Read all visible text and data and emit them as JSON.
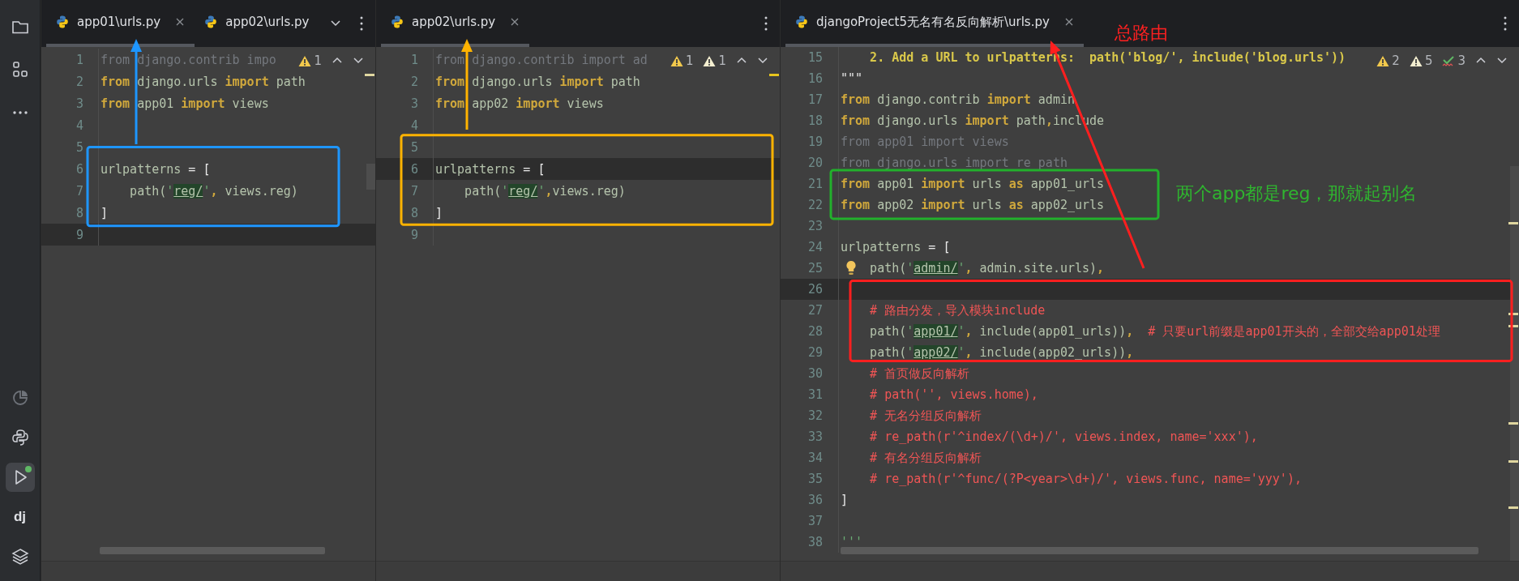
{
  "sidebar": {
    "top": [
      {
        "selected": false
      },
      {
        "selected": false
      },
      {
        "selected": false
      }
    ],
    "bottom": [
      {
        "kind": "icon",
        "selected": false
      },
      {
        "kind": "icon",
        "selected": false
      },
      {
        "kind": "icon",
        "selected": true,
        "running": true
      },
      {
        "kind": "label",
        "label": "dj",
        "selected": false
      },
      {
        "kind": "icon",
        "selected": false
      }
    ]
  },
  "panes": [
    {
      "tabs": [
        {
          "label": "app01\\urls.py",
          "selected": true,
          "closable": true
        },
        {
          "label": "app02\\urls.py",
          "selected": false,
          "closable": false
        }
      ],
      "tab_overflow": true,
      "inspections": [
        {
          "kind": "warning",
          "count": "1"
        }
      ],
      "lines": [
        {
          "number": "1",
          "current": false,
          "segments": [
            {
              "text": "from django.contrib impo",
              "kind": "dim"
            }
          ]
        },
        {
          "number": "2",
          "current": false,
          "segments": [
            {
              "text": "from",
              "kind": "kw"
            },
            {
              "text": " django.urls ",
              "kind": "id"
            },
            {
              "text": "import",
              "kind": "kw"
            },
            {
              "text": " path",
              "kind": "id"
            }
          ]
        },
        {
          "number": "3",
          "current": false,
          "segments": [
            {
              "text": "from",
              "kind": "kw"
            },
            {
              "text": " app01 ",
              "kind": "id"
            },
            {
              "text": "import",
              "kind": "kw"
            },
            {
              "text": " views",
              "kind": "id"
            }
          ]
        },
        {
          "number": "4",
          "current": false
        },
        {
          "number": "5",
          "current": false
        },
        {
          "number": "6",
          "current": false,
          "segments": [
            {
              "text": "urlpatterns",
              "kind": "id"
            },
            {
              "text": " = [",
              "kind": "op"
            }
          ]
        },
        {
          "number": "7",
          "current": false,
          "segments": [
            {
              "text": "    path(",
              "kind": "id"
            },
            {
              "text": "'",
              "kind": "str"
            },
            {
              "text": "reg/",
              "kind": "route"
            },
            {
              "text": "'",
              "kind": "str"
            },
            {
              "text": ",",
              "kind": "kw"
            },
            {
              "text": " views.reg)",
              "kind": "id"
            }
          ]
        },
        {
          "number": "8",
          "current": false,
          "segments": [
            {
              "text": "]",
              "kind": "op"
            }
          ]
        },
        {
          "number": "9",
          "current": true
        }
      ]
    },
    {
      "tabs": [
        {
          "label": "app02\\urls.py",
          "selected": true,
          "closable": true
        }
      ],
      "tab_overflow": false,
      "inspections": [
        {
          "kind": "warning",
          "count": "1"
        },
        {
          "kind": "weak",
          "count": "1"
        }
      ],
      "lines": [
        {
          "number": "1",
          "current": false,
          "segments": [
            {
              "text": "from django.contrib import ad",
              "kind": "dim"
            }
          ]
        },
        {
          "number": "2",
          "current": false,
          "segments": [
            {
              "text": "from",
              "kind": "kw"
            },
            {
              "text": " django.urls ",
              "kind": "id"
            },
            {
              "text": "import",
              "kind": "kw"
            },
            {
              "text": " path",
              "kind": "id"
            }
          ]
        },
        {
          "number": "3",
          "current": false,
          "segments": [
            {
              "text": "from",
              "kind": "kw"
            },
            {
              "text": " app02 ",
              "kind": "id"
            },
            {
              "text": "import",
              "kind": "kw"
            },
            {
              "text": " views",
              "kind": "id"
            }
          ]
        },
        {
          "number": "4",
          "current": false
        },
        {
          "number": "5",
          "current": false
        },
        {
          "number": "6",
          "current": true,
          "segments": [
            {
              "text": "urlpatterns",
              "kind": "id"
            },
            {
              "text": " = [",
              "kind": "op"
            }
          ]
        },
        {
          "number": "7",
          "current": false,
          "segments": [
            {
              "text": "    path(",
              "kind": "id"
            },
            {
              "text": "'",
              "kind": "str"
            },
            {
              "text": "reg/",
              "kind": "route"
            },
            {
              "text": "'",
              "kind": "str"
            },
            {
              "text": ",",
              "kind": "kw"
            },
            {
              "text": "views.reg)",
              "kind": "id"
            }
          ]
        },
        {
          "number": "8",
          "current": false,
          "segments": [
            {
              "text": "]",
              "kind": "op"
            }
          ]
        },
        {
          "number": "9",
          "current": false
        }
      ]
    },
    {
      "tabs": [
        {
          "label": "djangoProject5无名有名反向解析\\urls.py",
          "selected": true,
          "closable": true
        }
      ],
      "tab_overflow": false,
      "inspections": [
        {
          "kind": "warning",
          "count": "2"
        },
        {
          "kind": "weak",
          "count": "5"
        },
        {
          "kind": "typo",
          "count": "3"
        }
      ],
      "lines": [
        {
          "number": "15",
          "current": false,
          "segments": [
            {
              "text": "    2. Add a URL to urlpatterns:  path('blog/', include('blog.urls'))",
              "kind": "doc"
            }
          ]
        },
        {
          "number": "16",
          "current": false,
          "segments": [
            {
              "text": "\"\"\"",
              "kind": "op"
            }
          ]
        },
        {
          "number": "17",
          "current": false,
          "segments": [
            {
              "text": "from",
              "kind": "kw"
            },
            {
              "text": " django.contrib ",
              "kind": "id"
            },
            {
              "text": "import",
              "kind": "kw"
            },
            {
              "text": " admin",
              "kind": "id"
            }
          ]
        },
        {
          "number": "18",
          "current": false,
          "segments": [
            {
              "text": "from",
              "kind": "kw"
            },
            {
              "text": " django.urls ",
              "kind": "id"
            },
            {
              "text": "import",
              "kind": "kw"
            },
            {
              "text": " path",
              "kind": "id"
            },
            {
              "text": ",",
              "kind": "kw"
            },
            {
              "text": "include",
              "kind": "id"
            }
          ]
        },
        {
          "number": "19",
          "current": false,
          "segments": [
            {
              "text": "from app01 import views",
              "kind": "dim"
            }
          ]
        },
        {
          "number": "20",
          "current": false,
          "segments": [
            {
              "text": "from django.urls import re_path",
              "kind": "dim"
            }
          ]
        },
        {
          "number": "21",
          "current": false,
          "segments": [
            {
              "text": "from",
              "kind": "kw"
            },
            {
              "text": " app01 ",
              "kind": "id"
            },
            {
              "text": "import",
              "kind": "kw"
            },
            {
              "text": " urls ",
              "kind": "id"
            },
            {
              "text": "as",
              "kind": "kw"
            },
            {
              "text": " app01_urls",
              "kind": "id"
            }
          ]
        },
        {
          "number": "22",
          "current": false,
          "segments": [
            {
              "text": "from",
              "kind": "kw"
            },
            {
              "text": " app02 ",
              "kind": "id"
            },
            {
              "text": "import",
              "kind": "kw"
            },
            {
              "text": " urls ",
              "kind": "id"
            },
            {
              "text": "as",
              "kind": "kw"
            },
            {
              "text": " app02_urls",
              "kind": "id"
            }
          ]
        },
        {
          "number": "23",
          "current": false
        },
        {
          "number": "24",
          "current": false,
          "segments": [
            {
              "text": "urlpatterns",
              "kind": "id"
            },
            {
              "text": " = [",
              "kind": "op"
            }
          ]
        },
        {
          "number": "25",
          "current": false,
          "hint_bulb": true,
          "segments": [
            {
              "text": "    path(",
              "kind": "id"
            },
            {
              "text": "'",
              "kind": "str"
            },
            {
              "text": "admin/",
              "kind": "route"
            },
            {
              "text": "'",
              "kind": "str"
            },
            {
              "text": ",",
              "kind": "kw"
            },
            {
              "text": " admin.site.urls)",
              "kind": "id"
            },
            {
              "text": ",",
              "kind": "kw"
            }
          ]
        },
        {
          "number": "26",
          "current": true
        },
        {
          "number": "27",
          "current": false,
          "segments": [
            {
              "text": "    # 路由分发，导入模块include",
              "kind": "cm"
            }
          ]
        },
        {
          "number": "28",
          "current": false,
          "segments": [
            {
              "text": "    path(",
              "kind": "id"
            },
            {
              "text": "'",
              "kind": "str"
            },
            {
              "text": "app01/",
              "kind": "route"
            },
            {
              "text": "'",
              "kind": "str"
            },
            {
              "text": ",",
              "kind": "kw"
            },
            {
              "text": " include(app01_urls))",
              "kind": "id"
            },
            {
              "text": ",",
              "kind": "kw"
            },
            {
              "text": "  # 只要url前缀是app01开头的，全部交给app01处理",
              "kind": "cm"
            }
          ]
        },
        {
          "number": "29",
          "current": false,
          "segments": [
            {
              "text": "    path(",
              "kind": "id"
            },
            {
              "text": "'",
              "kind": "str"
            },
            {
              "text": "app02/",
              "kind": "route"
            },
            {
              "text": "'",
              "kind": "str"
            },
            {
              "text": ",",
              "kind": "kw"
            },
            {
              "text": " include(app02_urls))",
              "kind": "id"
            },
            {
              "text": ",",
              "kind": "kw"
            }
          ]
        },
        {
          "number": "30",
          "current": false,
          "segments": [
            {
              "text": "    # 首页做反向解析",
              "kind": "cm"
            }
          ]
        },
        {
          "number": "31",
          "current": false,
          "segments": [
            {
              "text": "    # path('', views.home),",
              "kind": "cm"
            }
          ]
        },
        {
          "number": "32",
          "current": false,
          "segments": [
            {
              "text": "    # 无名分组反向解析",
              "kind": "cm"
            }
          ]
        },
        {
          "number": "33",
          "current": false,
          "segments": [
            {
              "text": "    # re_path(r'^index/(\\d+)/', views.index, name='xxx'),",
              "kind": "cm"
            }
          ]
        },
        {
          "number": "34",
          "current": false,
          "segments": [
            {
              "text": "    # 有名分组反向解析",
              "kind": "cm"
            }
          ]
        },
        {
          "number": "35",
          "current": false,
          "segments": [
            {
              "text": "    # re_path(r'^func/(?P<year>\\d+)/', views.func, name='yyy'),",
              "kind": "cm"
            }
          ]
        },
        {
          "number": "36",
          "current": false,
          "segments": [
            {
              "text": "]",
              "kind": "op"
            }
          ]
        },
        {
          "number": "37",
          "current": false
        },
        {
          "number": "38",
          "current": false,
          "segments": [
            {
              "text": "'''",
              "kind": "str"
            }
          ]
        }
      ],
      "annotations": [
        {
          "kind": "title-note",
          "text": "总路由"
        },
        {
          "kind": "side-note",
          "text": "两个app都是reg，那就起别名"
        }
      ]
    }
  ]
}
